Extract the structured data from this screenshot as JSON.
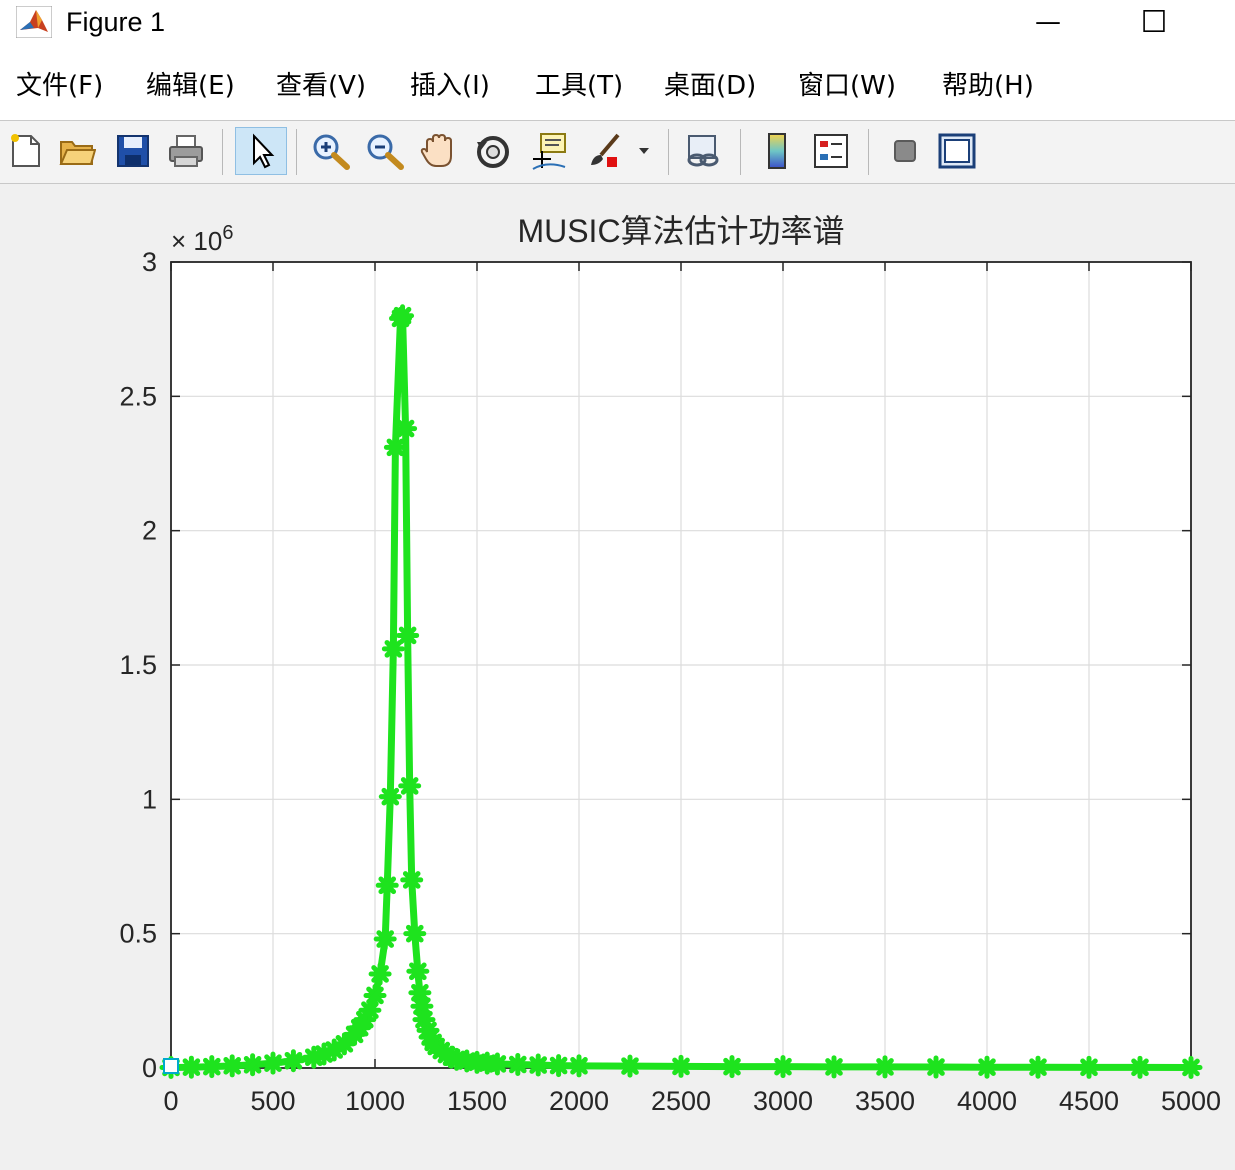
{
  "window": {
    "title": "Figure 1",
    "minimize_glyph": "—",
    "maximize_glyph": "☐"
  },
  "menu": [
    {
      "label": "文件(F)"
    },
    {
      "label": "编辑(E)"
    },
    {
      "label": "查看(V)"
    },
    {
      "label": "插入(I)"
    },
    {
      "label": "工具(T)"
    },
    {
      "label": "桌面(D)"
    },
    {
      "label": "窗口(W)"
    },
    {
      "label": "帮助(H)"
    }
  ],
  "toolbar": [
    {
      "icon": "new-figure-icon"
    },
    {
      "icon": "open-file-icon"
    },
    {
      "icon": "save-icon"
    },
    {
      "icon": "print-icon"
    },
    {
      "icon": "select-arrow-icon",
      "active": true
    },
    {
      "icon": "zoom-in-icon"
    },
    {
      "icon": "zoom-out-icon"
    },
    {
      "icon": "pan-hand-icon"
    },
    {
      "icon": "rotate-3d-icon"
    },
    {
      "icon": "data-cursor-icon"
    },
    {
      "icon": "brush-icon"
    },
    {
      "icon": "link-plot-icon"
    },
    {
      "icon": "colorbar-icon"
    },
    {
      "icon": "legend-icon"
    },
    {
      "icon": "hide-plot-tools-icon"
    },
    {
      "icon": "show-plot-tools-icon"
    }
  ],
  "chart_data": {
    "type": "line",
    "title": "MUSIC算法估计功率谱",
    "xlabel": "",
    "ylabel": "",
    "xlim": [
      0,
      5000
    ],
    "ylim": [
      0,
      3000000
    ],
    "y_exponent_label": "× 10",
    "y_exponent": "6",
    "x_ticks": [
      0,
      500,
      1000,
      1500,
      2000,
      2500,
      3000,
      3500,
      4000,
      4500,
      5000
    ],
    "x_tick_labels": [
      "0",
      "500",
      "1000",
      "1500",
      "2000",
      "2500",
      "3000",
      "3500",
      "4000",
      "4500",
      "5000"
    ],
    "y_ticks": [
      0,
      500000,
      1000000,
      1500000,
      2000000,
      2500000,
      3000000
    ],
    "y_tick_labels": [
      "0",
      "0.5",
      "1",
      "1.5",
      "2",
      "2.5",
      "3"
    ],
    "grid": true,
    "marker": "asterisk",
    "colors": {
      "series": "#1ee31e",
      "axes": "#262626",
      "grid": "#dcdcdc",
      "origin_marker": "#00aacc"
    },
    "series": [
      {
        "x": [
          0,
          100,
          200,
          300,
          400,
          500,
          600,
          700,
          750,
          800,
          850,
          900,
          925,
          950,
          975,
          1000,
          1025,
          1050,
          1060,
          1075,
          1090,
          1100,
          1125,
          1135,
          1150,
          1160,
          1170,
          1180,
          1195,
          1210,
          1220,
          1230,
          1240,
          1260,
          1270,
          1285,
          1300,
          1325,
          1350,
          1375,
          1400,
          1450,
          1500,
          1550,
          1600,
          1700,
          1800,
          1900,
          2000,
          2250,
          2500,
          2750,
          3000,
          3250,
          3500,
          3750,
          4000,
          4250,
          4500,
          4750,
          5000
        ],
        "y": [
          2000,
          3000,
          5000,
          8000,
          12000,
          18000,
          27000,
          40000,
          52000,
          67000,
          90000,
          125000,
          150000,
          180000,
          215000,
          270000,
          350000,
          480000,
          680000,
          1010000,
          1560000,
          2310000,
          2790000,
          2800000,
          2380000,
          1610000,
          1050000,
          700000,
          500000,
          360000,
          280000,
          230000,
          180000,
          140000,
          115000,
          95000,
          80000,
          65000,
          50000,
          40000,
          32000,
          26000,
          21000,
          18000,
          15000,
          13000,
          11000,
          9000,
          8000,
          7000,
          6000,
          5000,
          5000,
          4000,
          4000,
          3500,
          3000,
          3000,
          2500,
          2500,
          2000
        ]
      }
    ]
  }
}
